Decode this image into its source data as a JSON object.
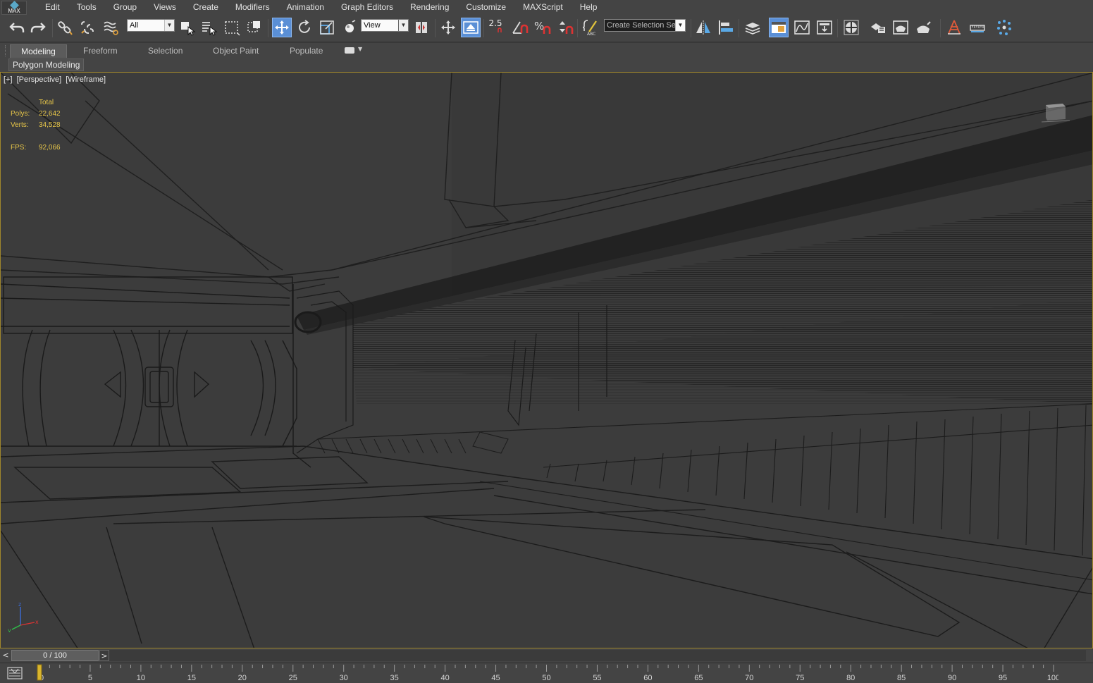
{
  "app": {
    "logo_text": "MAX"
  },
  "menu": [
    "Edit",
    "Tools",
    "Group",
    "Views",
    "Create",
    "Modifiers",
    "Animation",
    "Graph Editors",
    "Rendering",
    "Customize",
    "MAXScript",
    "Help"
  ],
  "toolbar": {
    "selection_filter": "All",
    "reference_coordinate": "View",
    "snap_value": "2.5",
    "selection_set": "Create Selection Se",
    "icons": [
      "undo-icon",
      "redo-icon",
      "link-icon",
      "unlink-icon",
      "bind-space-warp-icon",
      "select-object-icon",
      "select-by-name-icon",
      "rectangular-selection-icon",
      "window-crossing-icon",
      "select-move-icon",
      "select-rotate-icon",
      "select-scale-icon",
      "pivot-icon",
      "manipulate-icon",
      "keyboard-shortcut-icon",
      "snaps-toggle-icon",
      "angle-snap-icon",
      "percent-snap-icon",
      "spinner-snap-icon",
      "edit-named-selection-icon",
      "mirror-icon",
      "align-icon",
      "layer-explorer-icon",
      "scene-explorer-icon",
      "curve-editor-icon",
      "schematic-view-icon",
      "material-editor-icon",
      "render-setup-icon",
      "rendered-frame-window-icon",
      "render-production-icon",
      "render-iterative-icon"
    ]
  },
  "ribbon": {
    "tabs": [
      "Modeling",
      "Freeform",
      "Selection",
      "Object Paint",
      "Populate"
    ],
    "active_tab": "Modeling",
    "panel_label": "Polygon Modeling"
  },
  "viewport": {
    "labels": [
      "[+]",
      "[Perspective]",
      "[Wireframe]"
    ],
    "stats": {
      "header": "Total",
      "polys_label": "Polys:",
      "polys_value": "22,642",
      "verts_label": "Verts:",
      "verts_value": "34,528",
      "fps_label": "FPS:",
      "fps_value": "92,066"
    },
    "border_color": "#a0872c",
    "stats_color": "#e7c649"
  },
  "timeline": {
    "frame_display": "0 / 100",
    "prev": "<",
    "next": ">",
    "ticks": [
      0,
      5,
      10,
      15,
      20,
      25,
      30,
      35,
      40,
      45,
      50,
      55,
      60,
      65,
      70,
      75,
      80,
      85,
      90,
      95,
      100
    ],
    "current_frame": 0
  }
}
